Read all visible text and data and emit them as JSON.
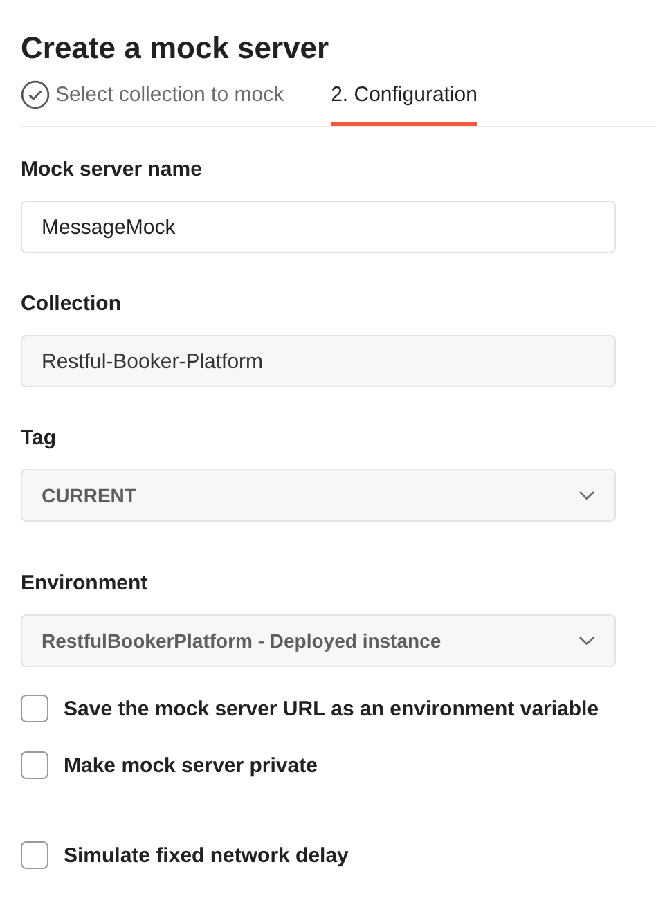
{
  "title": "Create a mock server",
  "tabs": [
    {
      "label": "Select collection to mock",
      "selected": false,
      "completed": true
    },
    {
      "label": "2. Configuration",
      "selected": true,
      "completed": false
    }
  ],
  "fields": [
    {
      "label": "Mock server name",
      "kind": "text",
      "value": "MessageMock"
    },
    {
      "label": "Collection",
      "kind": "readonly",
      "value": "Restful-Booker-Platform"
    },
    {
      "label": "Tag",
      "kind": "select",
      "value": "CURRENT"
    },
    {
      "label": "Environment",
      "kind": "select",
      "value": "RestfulBookerPlatform - Deployed instance"
    }
  ],
  "options": [
    {
      "label": "Save the mock server URL as an environment variable",
      "checked": false
    },
    {
      "label": "Make mock server private",
      "checked": false
    },
    {
      "label": "Simulate fixed network delay",
      "checked": false
    }
  ]
}
